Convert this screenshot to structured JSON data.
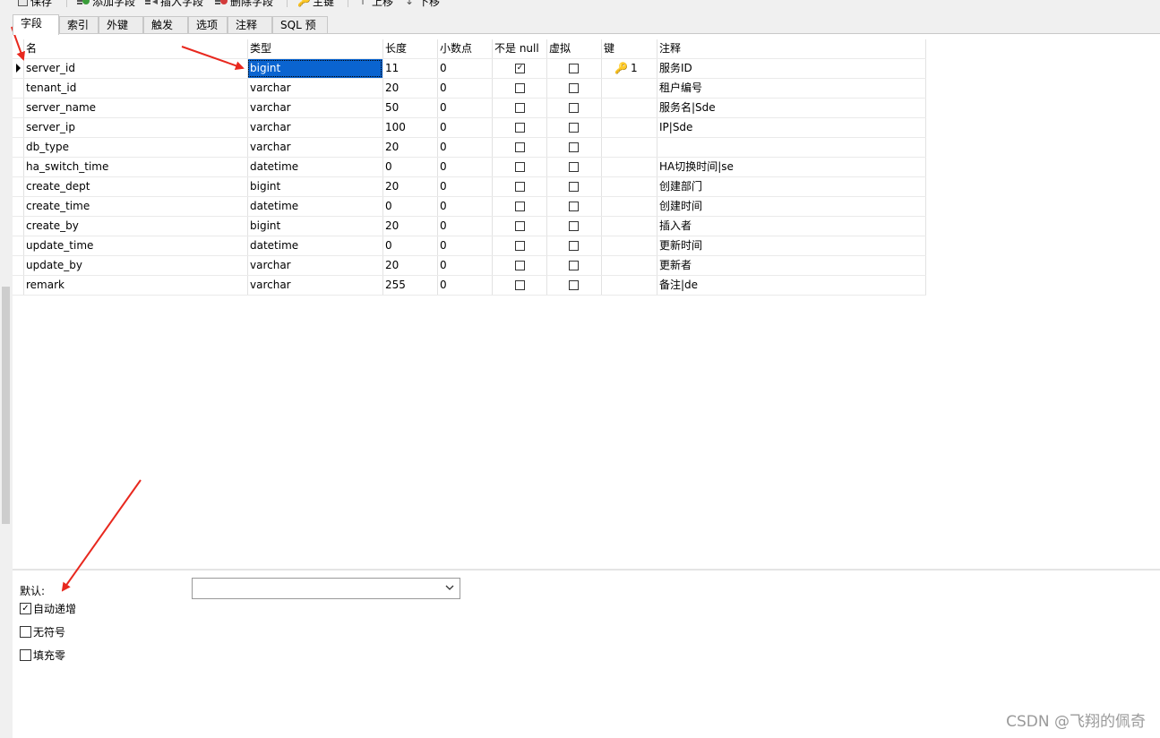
{
  "toolbar": {
    "save_label": "保存",
    "add_field_label": "添加字段",
    "insert_field_label": "插入字段",
    "delete_field_label": "删除字段",
    "primary_key_label": "主键",
    "move_up_label": "上移",
    "move_down_label": "下移"
  },
  "tabs": [
    "字段",
    "索引",
    "外键",
    "触发器",
    "选项",
    "注释",
    "SQL 预览"
  ],
  "active_tab": "字段",
  "grid": {
    "columns": [
      "名",
      "类型",
      "长度",
      "小数点",
      "不是 null",
      "虚拟",
      "键",
      "注释"
    ],
    "rows": [
      {
        "name": "server_id",
        "type": "bigint",
        "length": "11",
        "decimals": "0",
        "not_null": true,
        "virtual": false,
        "key": "1",
        "comment": "服务ID"
      },
      {
        "name": "tenant_id",
        "type": "varchar",
        "length": "20",
        "decimals": "0",
        "not_null": false,
        "virtual": false,
        "key": "",
        "comment": "租户编号"
      },
      {
        "name": "server_name",
        "type": "varchar",
        "length": "50",
        "decimals": "0",
        "not_null": false,
        "virtual": false,
        "key": "",
        "comment": "服务名|Sde"
      },
      {
        "name": "server_ip",
        "type": "varchar",
        "length": "100",
        "decimals": "0",
        "not_null": false,
        "virtual": false,
        "key": "",
        "comment": "IP|Sde"
      },
      {
        "name": "db_type",
        "type": "varchar",
        "length": "20",
        "decimals": "0",
        "not_null": false,
        "virtual": false,
        "key": "",
        "comment": ""
      },
      {
        "name": "ha_switch_time",
        "type": "datetime",
        "length": "0",
        "decimals": "0",
        "not_null": false,
        "virtual": false,
        "key": "",
        "comment": "HA切换时间|se"
      },
      {
        "name": "create_dept",
        "type": "bigint",
        "length": "20",
        "decimals": "0",
        "not_null": false,
        "virtual": false,
        "key": "",
        "comment": "创建部门"
      },
      {
        "name": "create_time",
        "type": "datetime",
        "length": "0",
        "decimals": "0",
        "not_null": false,
        "virtual": false,
        "key": "",
        "comment": "创建时间"
      },
      {
        "name": "create_by",
        "type": "bigint",
        "length": "20",
        "decimals": "0",
        "not_null": false,
        "virtual": false,
        "key": "",
        "comment": "插入者"
      },
      {
        "name": "update_time",
        "type": "datetime",
        "length": "0",
        "decimals": "0",
        "not_null": false,
        "virtual": false,
        "key": "",
        "comment": "更新时间"
      },
      {
        "name": "update_by",
        "type": "varchar",
        "length": "20",
        "decimals": "0",
        "not_null": false,
        "virtual": false,
        "key": "",
        "comment": "更新者"
      },
      {
        "name": "remark",
        "type": "varchar",
        "length": "255",
        "decimals": "0",
        "not_null": false,
        "virtual": false,
        "key": "",
        "comment": "备注|de"
      }
    ]
  },
  "properties": {
    "default_label": "默认:",
    "default_value": "",
    "auto_increment_label": "自动递增",
    "auto_increment_checked": true,
    "unsigned_label": "无符号",
    "unsigned_checked": false,
    "zerofill_label": "填充零",
    "zerofill_checked": false
  },
  "watermark": "CSDN @飞翔的佩奇",
  "colors": {
    "selection": "#0a64d0",
    "annotation_arrow": "#e8281e",
    "key_icon": "#d8a21c"
  }
}
